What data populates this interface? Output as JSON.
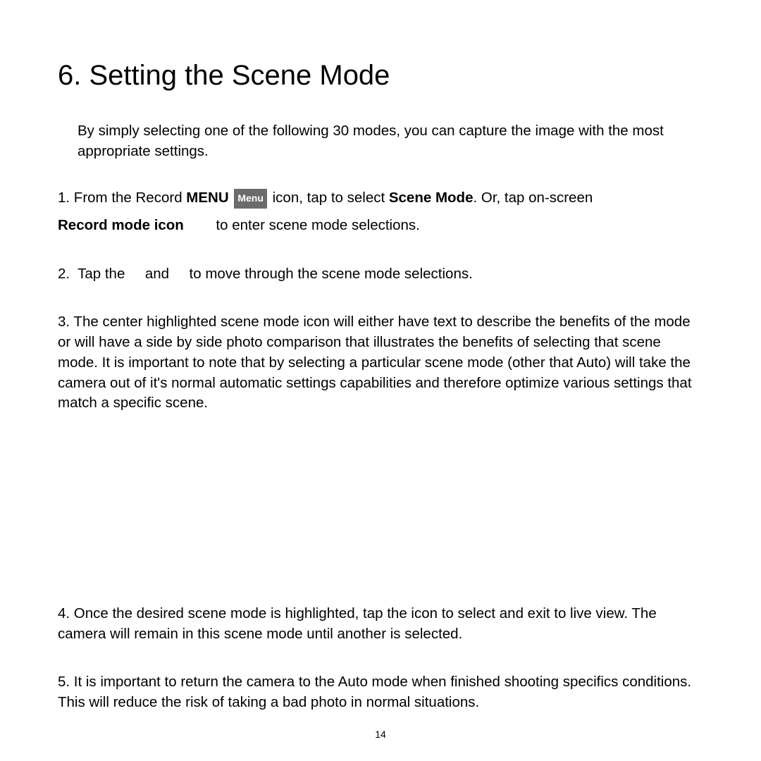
{
  "heading": "6. Setting the Scene Mode",
  "intro": "By simply selecting one of the following 30 modes, you can capture the image with the most appropriate settings.",
  "step1": {
    "prefix": "1.  From the Record ",
    "menu_bold": "MENU",
    "menu_icon_label": "Menu",
    "mid": " icon, tap to select ",
    "scene_mode_bold": "Scene Mode",
    "suffix": ". Or, tap on-screen",
    "record_line_prefix_bold": "Record mode icon",
    "record_line_suffix": "        to enter scene mode selections."
  },
  "step2": "2.  Tap the     and     to move through the scene mode selections.",
  "step3": "3.  The center highlighted scene mode icon will either have text to describe the benefits of the mode or will have a side by side photo comparison that illustrates the benefits of selecting that scene mode.  It is important to note that by selecting a particular scene mode (other that Auto) will take the camera out of it's normal automatic settings capabilities and therefore optimize various settings that match a specific scene.",
  "step4": "4.  Once the desired scene mode is highlighted, tap the icon to select and exit to live view. The camera will remain in this scene mode until another is selected.",
  "step5": "5.  It is important to return the camera to the Auto mode when finished shooting specifics conditions. This will reduce the risk of taking a bad photo in normal situations.",
  "page_number": "14"
}
